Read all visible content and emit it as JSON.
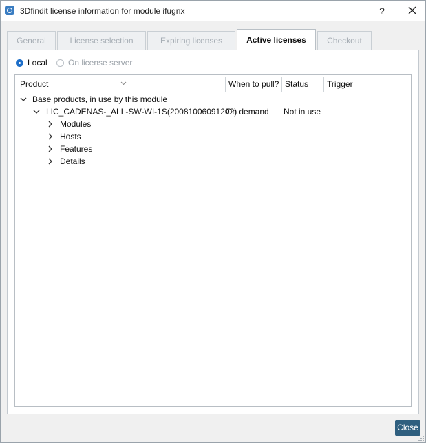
{
  "window": {
    "title": "3Dfindit license information for module ifugnx",
    "help": "?"
  },
  "tabs": [
    {
      "label": "General",
      "active": false
    },
    {
      "label": "License selection",
      "active": false
    },
    {
      "label": "Expiring licenses",
      "active": false
    },
    {
      "label": "Active licenses",
      "active": true
    },
    {
      "label": "Checkout",
      "active": false
    }
  ],
  "source": {
    "local": "Local",
    "server": "On license server",
    "selected": "Local"
  },
  "columns": {
    "product": "Product",
    "when": "When to pull?",
    "status": "Status",
    "trigger": "Trigger"
  },
  "tree": {
    "group": "Base products, in use by this module",
    "license": {
      "name": "LIC_CADENAS-_ALL-SW-WI-1S(20081006091202)",
      "when": "On demand",
      "status": "Not in use",
      "trigger": ""
    },
    "children": [
      "Modules",
      "Hosts",
      "Features",
      "Details"
    ]
  },
  "footer": {
    "close": "Close"
  },
  "colors": {
    "accent": "#1e6fc9",
    "close_button": "#2f5f7f"
  }
}
